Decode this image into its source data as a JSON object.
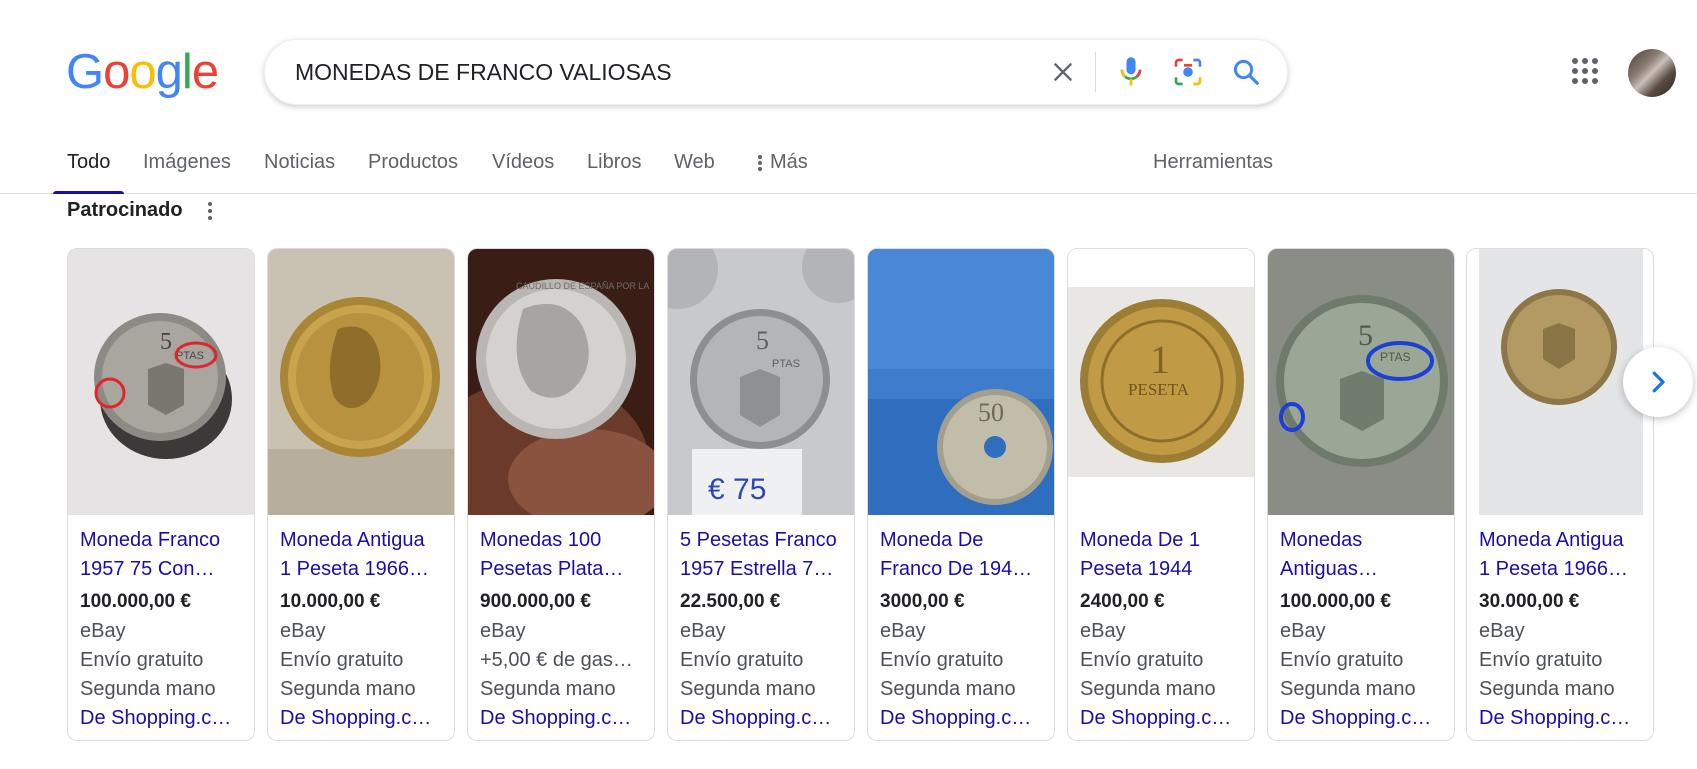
{
  "logo": {
    "letters": [
      "G",
      "o",
      "o",
      "g",
      "l",
      "e"
    ],
    "colors": [
      "#4285F4",
      "#EA4335",
      "#FBBC05",
      "#4285F4",
      "#34A853",
      "#EA4335"
    ]
  },
  "search": {
    "query": "MONEDAS DE FRANCO VALIOSAS"
  },
  "header_icons": [
    "clear-icon",
    "microphone-icon",
    "camera-lens-icon",
    "search-icon",
    "apps-grid-icon",
    "avatar"
  ],
  "tabs": {
    "items": [
      "Todo",
      "Imágenes",
      "Noticias",
      "Productos",
      "Vídeos",
      "Libros",
      "Web"
    ],
    "more": "Más",
    "tools": "Herramientas",
    "active": "Todo"
  },
  "sponsored": {
    "label": "Patrocinado"
  },
  "products": [
    {
      "title1": "Moneda Franco",
      "title2": "1957 75 Con…",
      "price": "100.000,00 €",
      "store": "eBay",
      "shipping": "Envío gratuito",
      "condition": "Segunda mano",
      "source": "De Shopping.c…"
    },
    {
      "title1": "Moneda Antigua",
      "title2": "1 Peseta 1966…",
      "price": "10.000,00 €",
      "store": "eBay",
      "shipping": "Envío gratuito",
      "condition": "Segunda mano",
      "source": "De Shopping.c…"
    },
    {
      "title1": "Monedas 100",
      "title2": "Pesetas Plata…",
      "price": "900.000,00 €",
      "store": "eBay",
      "shipping": "+5,00 € de gas…",
      "condition": "Segunda mano",
      "source": "De Shopping.c…"
    },
    {
      "title1": "5 Pesetas Franco",
      "title2": "1957 Estrella 7…",
      "price": "22.500,00 €",
      "store": "eBay",
      "shipping": "Envío gratuito",
      "condition": "Segunda mano",
      "source": "De Shopping.c…"
    },
    {
      "title1": "Moneda De",
      "title2": "Franco De 194…",
      "price": "3000,00 €",
      "store": "eBay",
      "shipping": "Envío gratuito",
      "condition": "Segunda mano",
      "source": "De Shopping.c…"
    },
    {
      "title1": "Moneda De 1",
      "title2": "Peseta 1944",
      "price": "2400,00 €",
      "store": "eBay",
      "shipping": "Envío gratuito",
      "condition": "Segunda mano",
      "source": "De Shopping.c…"
    },
    {
      "title1": "Monedas",
      "title2": "Antiguas…",
      "price": "100.000,00 €",
      "store": "eBay",
      "shipping": "Envío gratuito",
      "condition": "Segunda mano",
      "source": "De Shopping.c…"
    },
    {
      "title1": "Moneda Antigua",
      "title2": "1 Peseta 1966…",
      "price": "30.000,00 €",
      "store": "eBay",
      "shipping": "Envío gratuito",
      "condition": "Segunda mano",
      "source": "De Shopping.c…"
    }
  ],
  "coin_text": {
    "c1_value": "5",
    "c1_unit": "PTAS",
    "c3_legend": "CAUDILLO DE ESPAÑA POR LA",
    "c4_value": "5",
    "c4_unit": "PTAS",
    "c4_tag": "€ 75",
    "c5_value": "50",
    "c6_value": "1",
    "c6_unit": "PESETA",
    "c7_value": "5",
    "c7_unit": "PTAS"
  }
}
